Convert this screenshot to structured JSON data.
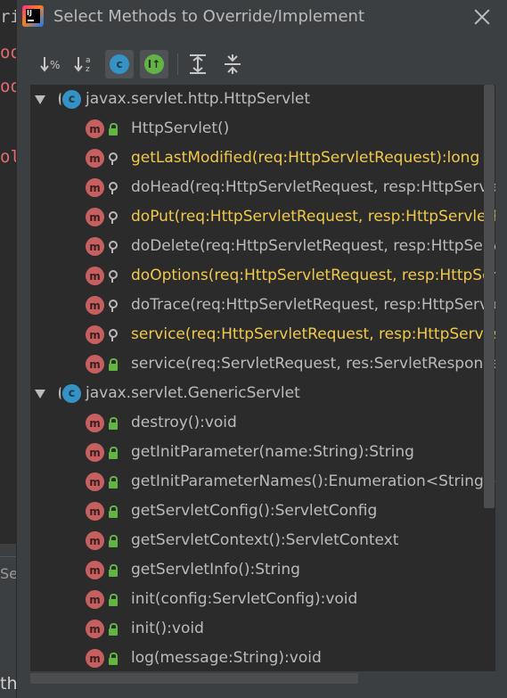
{
  "background": {
    "frag_top": "ri",
    "frag_lines": [
      "oo",
      "oo",
      "ol"
    ],
    "panel_text": "Se",
    "bottom_text": "th"
  },
  "dialog": {
    "title": "Select Methods to Override/Implement"
  },
  "toolbar": {
    "buttons": [
      {
        "name": "sort-by-visibility",
        "glyph": "↓%"
      },
      {
        "name": "sort-alphabetically",
        "glyph": "↓a z"
      },
      {
        "name": "show-classes",
        "glyph": "c"
      },
      {
        "name": "show-interfaces",
        "glyph": "I↑"
      },
      {
        "name": "expand-all",
        "glyph": "≡"
      },
      {
        "name": "collapse-all",
        "glyph": "≡"
      }
    ]
  },
  "tree": {
    "groups": [
      {
        "class_name": "javax.servlet.http.HttpServlet",
        "methods": [
          {
            "label": "HttpServlet()",
            "visibility": "public",
            "highlight": false
          },
          {
            "label": "getLastModified(req:HttpServletRequest):long",
            "visibility": "protected",
            "highlight": true
          },
          {
            "label": "doHead(req:HttpServletRequest, resp:HttpServle",
            "visibility": "protected",
            "highlight": false
          },
          {
            "label": "doPut(req:HttpServletRequest, resp:HttpServletR",
            "visibility": "protected",
            "highlight": true
          },
          {
            "label": "doDelete(req:HttpServletRequest, resp:HttpServ",
            "visibility": "protected",
            "highlight": false
          },
          {
            "label": "doOptions(req:HttpServletRequest, resp:HttpSer",
            "visibility": "protected",
            "highlight": true
          },
          {
            "label": "doTrace(req:HttpServletRequest, resp:HttpServle",
            "visibility": "protected",
            "highlight": false
          },
          {
            "label": "service(req:HttpServletRequest, resp:HttpServletR",
            "visibility": "protected",
            "highlight": true
          },
          {
            "label": "service(req:ServletRequest, res:ServletResponse):",
            "visibility": "public",
            "highlight": false
          }
        ]
      },
      {
        "class_name": "javax.servlet.GenericServlet",
        "methods": [
          {
            "label": "destroy():void",
            "visibility": "public",
            "highlight": false
          },
          {
            "label": "getInitParameter(name:String):String",
            "visibility": "public",
            "highlight": false
          },
          {
            "label": "getInitParameterNames():Enumeration<String>",
            "visibility": "public",
            "highlight": false
          },
          {
            "label": "getServletConfig():ServletConfig",
            "visibility": "public",
            "highlight": false
          },
          {
            "label": "getServletContext():ServletContext",
            "visibility": "public",
            "highlight": false
          },
          {
            "label": "getServletInfo():String",
            "visibility": "public",
            "highlight": false
          },
          {
            "label": "init(config:ServletConfig):void",
            "visibility": "public",
            "highlight": false
          },
          {
            "label": "init():void",
            "visibility": "public",
            "highlight": false
          },
          {
            "label": "log(message:String):void",
            "visibility": "public",
            "highlight": false
          }
        ]
      }
    ]
  },
  "colors": {
    "highlight_text": "#f0c94c",
    "method_icon": "#c65f5f",
    "class_icon": "#3592c4",
    "public_lock": "#62b543"
  }
}
